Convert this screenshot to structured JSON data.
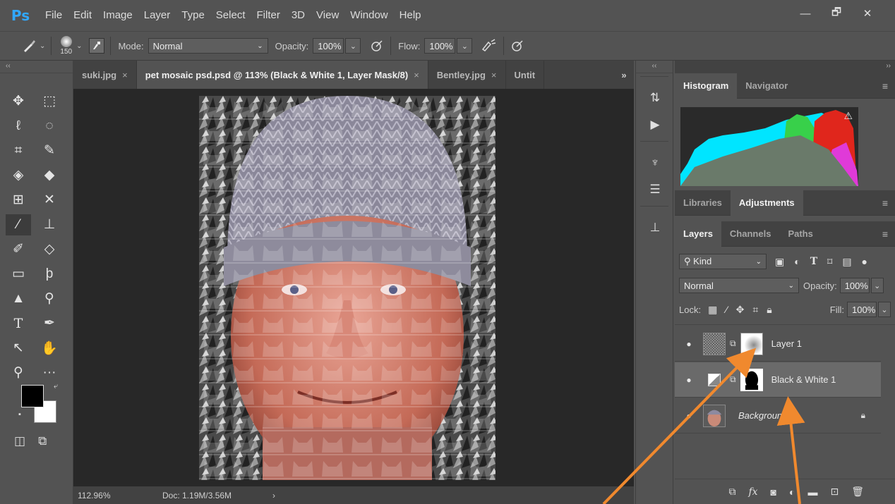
{
  "app": {
    "logo": "Ps"
  },
  "menu": [
    "File",
    "Edit",
    "Image",
    "Layer",
    "Type",
    "Select",
    "Filter",
    "3D",
    "View",
    "Window",
    "Help"
  ],
  "window_buttons": {
    "minimize": "—",
    "restore": "🗗",
    "close": "✕"
  },
  "options": {
    "brush_size": "150",
    "mode_label": "Mode:",
    "mode_value": "Normal",
    "opacity_label": "Opacity:",
    "opacity_value": "100%",
    "flow_label": "Flow:",
    "flow_value": "100%"
  },
  "tabs": [
    {
      "label": "suki.jpg",
      "active": false
    },
    {
      "label": "pet mosaic psd.psd @ 113% (Black & White 1, Layer Mask/8)",
      "active": true
    },
    {
      "label": "Bentley.jpg",
      "active": false
    },
    {
      "label": "Untit",
      "active": false
    }
  ],
  "tab_close": "×",
  "tab_overflow": "»",
  "status": {
    "zoom": "112.96%",
    "doc": "Doc: 1.19M/3.56M"
  },
  "histogram_panel": {
    "tabs": [
      "Histogram",
      "Navigator"
    ],
    "active": "Histogram",
    "warning": "⚠"
  },
  "adjustments_panel": {
    "tabs": [
      "Libraries",
      "Adjustments"
    ],
    "active": "Adjustments"
  },
  "layers_panel": {
    "tabs": [
      "Layers",
      "Channels",
      "Paths"
    ],
    "active": "Layers",
    "filter_kind": "Kind",
    "blend_mode": "Normal",
    "opacity_label": "Opacity:",
    "opacity_value": "100%",
    "lock_label": "Lock:",
    "fill_label": "Fill:",
    "fill_value": "100%",
    "layers": [
      {
        "name": "Layer 1",
        "visible": true,
        "selected": false
      },
      {
        "name": "Black & White 1",
        "visible": true,
        "selected": true
      },
      {
        "name": "Background",
        "visible": true,
        "selected": false,
        "locked": true
      }
    ]
  },
  "colors": {
    "ui_bg": "#535353",
    "dark_bg": "#424242",
    "canvas_bg": "#282828",
    "accent_arrow": "#f0892e",
    "ps_blue": "#31a8ff"
  }
}
